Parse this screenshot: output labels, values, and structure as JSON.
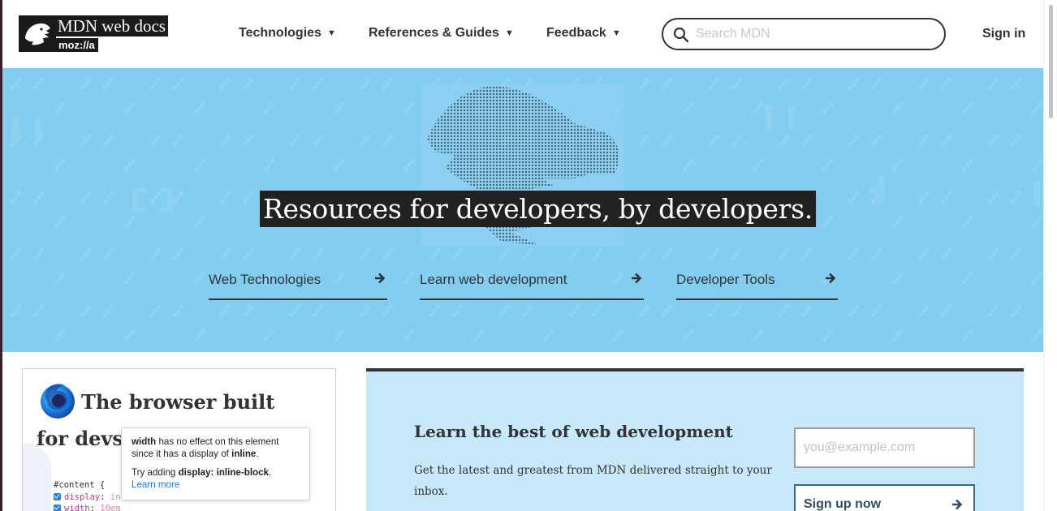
{
  "header": {
    "logo": {
      "title": "MDN web docs",
      "org": "moz://a"
    },
    "nav": [
      {
        "label": "Technologies"
      },
      {
        "label": "References & Guides"
      },
      {
        "label": "Feedback"
      }
    ],
    "search": {
      "placeholder": "Search MDN",
      "value": ""
    },
    "signin_label": "Sign in"
  },
  "hero": {
    "title": "Resources for developers, by developers.",
    "links": [
      {
        "label": "Web Technologies"
      },
      {
        "label": "Learn web development"
      },
      {
        "label": "Developer Tools"
      }
    ]
  },
  "promo": {
    "title": "The browser built for devs",
    "code": {
      "selector": "#content {",
      "line1_prop": "display",
      "line1_val": "inl",
      "line2_prop": "width",
      "line2_val": "10em"
    },
    "tooltip": {
      "line1_strong": "width",
      "line1_text": " has no effect on this element since it has a display of ",
      "line1_strong2": "inline",
      "line1_end": ".",
      "line2_text": "Try adding ",
      "line2_strong": "display: inline-block",
      "line2_end": ".",
      "learn_more": "Learn more"
    }
  },
  "newsletter": {
    "title": "Learn the best of web development",
    "description": "Get the latest and greatest from MDN delivered straight to your inbox.",
    "email_placeholder": "you@example.com",
    "signup_label": "Sign up now"
  },
  "colors": {
    "hero_bg": "#83cdf0",
    "newsletter_bg": "#c6e8f8",
    "text": "#333333",
    "title_bg": "#222222"
  },
  "icons": [
    "mdn-dino-logo-icon",
    "caret-down-icon",
    "search-icon",
    "arrow-right-icon",
    "firefox-developer-edition-icon",
    "checkbox-icon"
  ]
}
